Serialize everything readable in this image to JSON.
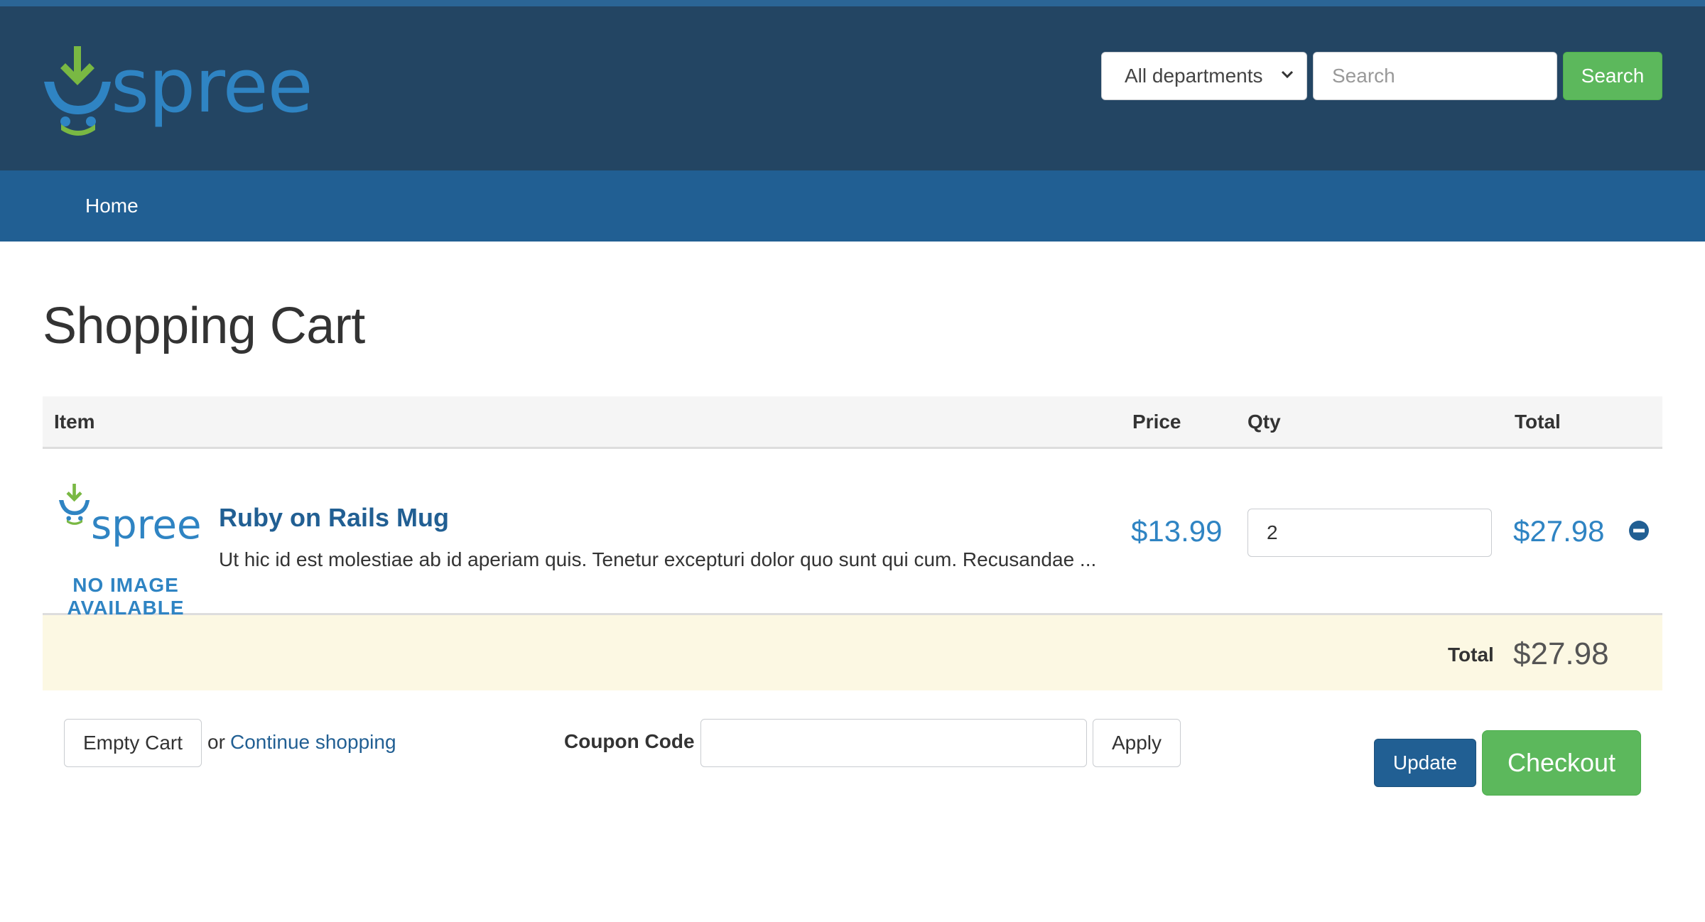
{
  "header": {
    "logo_text": "spree",
    "department_select": {
      "selected": "All departments"
    },
    "search": {
      "placeholder": "Search",
      "button_label": "Search"
    }
  },
  "nav": {
    "items": [
      {
        "label": "Home"
      }
    ]
  },
  "page": {
    "title": "Shopping Cart"
  },
  "cart_table": {
    "columns": {
      "item": "Item",
      "price": "Price",
      "qty": "Qty",
      "total": "Total"
    },
    "rows": [
      {
        "thumbnail_logo": "spree",
        "thumbnail_text": "NO IMAGE AVAILABLE",
        "name": "Ruby on Rails Mug",
        "description": "Ut hic id est molestiae ab id aperiam quis. Tenetur excepturi dolor quo sunt qui cum. Recusandae ...",
        "price": "$13.99",
        "quantity": "2",
        "total": "$27.98",
        "remove_icon": "minus-circle-icon"
      }
    ],
    "summary": {
      "label": "Total",
      "value": "$27.98"
    }
  },
  "actions": {
    "empty_cart_label": "Empty Cart",
    "or_text": "or",
    "continue_label": "Continue shopping",
    "coupon_label": "Coupon Code",
    "coupon_value": "",
    "apply_label": "Apply",
    "update_label": "Update",
    "checkout_label": "Checkout"
  },
  "colors": {
    "header_bg": "#234563",
    "nav_bg": "#215f93",
    "accent_green": "#5cb85c",
    "link_blue": "#215f93",
    "price_blue": "#2f84c3",
    "total_row_bg": "#fcf8e3"
  }
}
